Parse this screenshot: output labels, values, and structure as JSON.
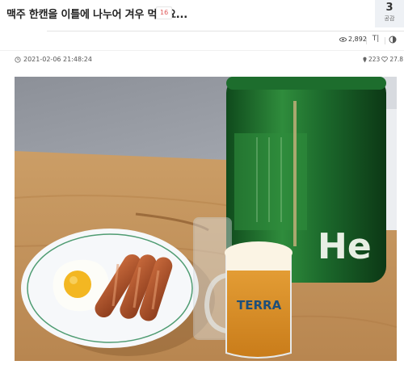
{
  "post": {
    "title": "맥주 한캔을 이틀에 나누어 겨우 먹어요...",
    "comment_count": "16",
    "vote_count": "3",
    "vote_label": "공감",
    "views": "2,892",
    "font_button": "T|",
    "date": "2021-02-06 21:48:24",
    "stat_a": "223",
    "stat_b": "27.8"
  },
  "photo": {
    "can_brand_text": "He",
    "glass_brand_text": "TERRA"
  },
  "icons": {
    "views": "eye-icon",
    "font_size": "font-size-icon",
    "theme": "contrast-icon",
    "date": "clock-icon",
    "location": "pin-icon",
    "like": "heart-icon"
  }
}
